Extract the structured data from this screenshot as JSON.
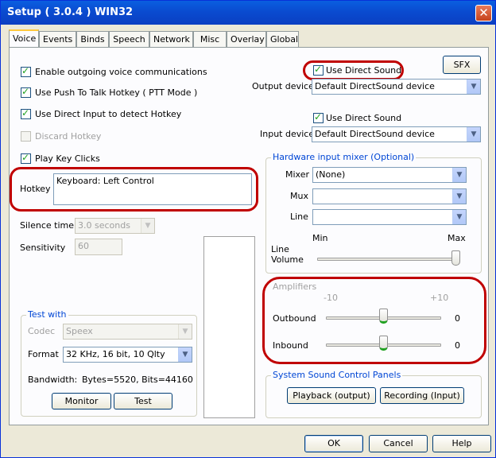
{
  "window": {
    "title": "Setup ( 3.0.4 ) WIN32",
    "close_glyph": "✕"
  },
  "tabs": [
    {
      "label": "Voice",
      "active": true
    },
    {
      "label": "Events"
    },
    {
      "label": "Binds"
    },
    {
      "label": "Speech"
    },
    {
      "label": "Network"
    },
    {
      "label": "Misc"
    },
    {
      "label": "Overlay"
    },
    {
      "label": "Global"
    }
  ],
  "left": {
    "enable_voice": {
      "label": "Enable outgoing voice communications",
      "checked": true
    },
    "ptt": {
      "label": "Use Push To Talk Hotkey ( PTT Mode )",
      "checked": true
    },
    "direct_input": {
      "label": "Use Direct Input to detect Hotkey",
      "checked": true
    },
    "discard": {
      "label": "Discard Hotkey",
      "checked": false,
      "enabled": false
    },
    "key_clicks": {
      "label": "Play Key Clicks",
      "checked": true
    },
    "hotkey_label": "Hotkey",
    "hotkey_value": "Keyboard: Left Control",
    "silence_label": "Silence time",
    "silence_value": "3.0 seconds",
    "sensitivity_label": "Sensitivity",
    "sensitivity_value": "60"
  },
  "test_group": {
    "title": "Test with",
    "codec_label": "Codec",
    "codec_value": "Speex",
    "format_label": "Format",
    "format_value": "32 KHz, 16 bit, 10 Qlty",
    "bandwidth_label": "Bandwidth:",
    "bandwidth_value": "Bytes=5520, Bits=44160",
    "monitor_button": "Monitor",
    "test_button": "Test"
  },
  "right": {
    "sfx_button": "SFX",
    "use_ds_output": {
      "label": "Use Direct Sound",
      "checked": true
    },
    "output_label": "Output device",
    "output_value": "Default DirectSound device",
    "use_ds_input": {
      "label": "Use Direct Sound",
      "checked": true
    },
    "input_label": "Input device",
    "input_value": "Default DirectSound device"
  },
  "mixer_group": {
    "title": "Hardware input mixer (Optional)",
    "mixer_label": "Mixer",
    "mixer_value": "(None)",
    "mux_label": "Mux",
    "mux_value": "",
    "line_label": "Line",
    "line_value": "",
    "min_label": "Min",
    "max_label": "Max",
    "line_volume_label_1": "Line",
    "line_volume_label_2": "Volume",
    "line_volume_level": 1.0
  },
  "amplifiers": {
    "title": "Amplifiers",
    "min_label": "-10",
    "max_label": "+10",
    "outbound_label": "Outbound",
    "outbound_value": "0",
    "inbound_label": "Inbound",
    "inbound_value": "0"
  },
  "sound_group": {
    "title": "System Sound Control Panels",
    "playback_button": "Playback (output)",
    "recording_button": "Recording (Input)"
  },
  "footer": {
    "ok": "OK",
    "cancel": "Cancel",
    "help": "Help"
  },
  "colors": {
    "annotation": "#c00000",
    "accent": "#0046d5"
  }
}
